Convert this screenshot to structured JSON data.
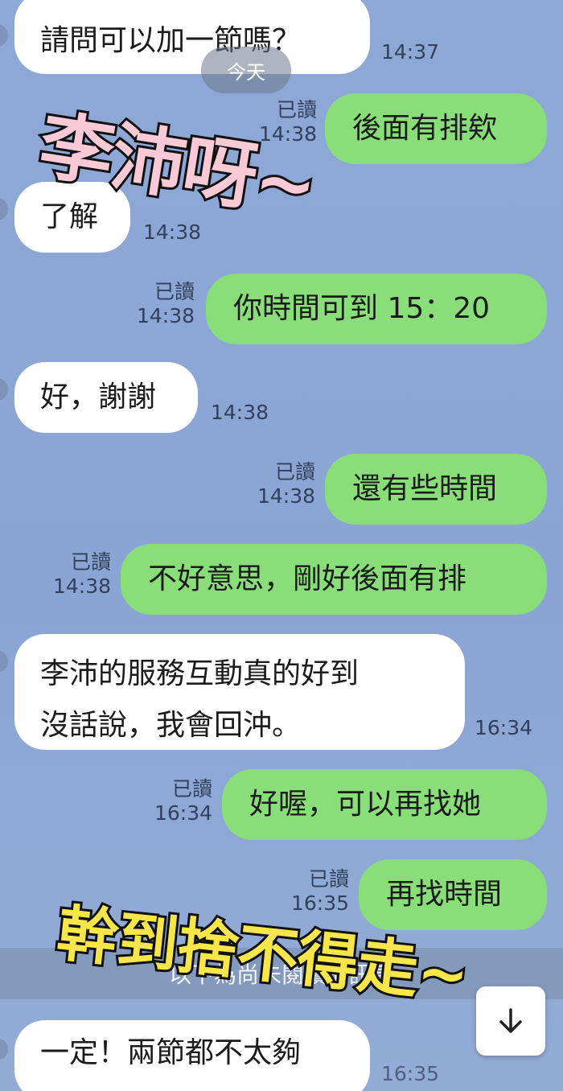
{
  "header": {
    "date_label": "今天"
  },
  "messages": [
    {
      "text": "請問可以加一節嗎？",
      "time": "14:37"
    },
    {
      "text": "後面有排欸",
      "read": "已讀",
      "time": "14:38"
    },
    {
      "text": "了解",
      "time": "14:38"
    },
    {
      "text": "你時間可到 15：20",
      "read": "已讀",
      "time": "14:38"
    },
    {
      "text": "好，謝謝",
      "time": "14:38"
    },
    {
      "text": "還有些時間",
      "read": "已讀",
      "time": "14:38"
    },
    {
      "text": "不好意思，剛好後面有排",
      "read": "已讀",
      "time": "14:38"
    },
    {
      "line1": "李沛的服務互動真的好到",
      "line2": "沒話說，我會回沖。",
      "time": "16:34"
    },
    {
      "text": "好喔，可以再找她",
      "read": "已讀",
      "time": "16:34"
    },
    {
      "text": "再找時間",
      "read": "已讀",
      "time": "16:35"
    },
    {
      "text": "一定！兩節都不太夠",
      "time": "16:35"
    }
  ],
  "overlays": {
    "top": "李沛呀~",
    "bottom": "幹到捨不得走~"
  },
  "unread_divider": "以下為尚未閱讀的訊息",
  "scroll_button": {
    "icon": "arrow-down-icon"
  },
  "colors": {
    "background": "#8da7d5",
    "incoming_bubble": "#ffffff",
    "outgoing_bubble": "#8ade79",
    "overlay_top": "#f9c9d6",
    "overlay_bottom": "#f7e64a"
  }
}
